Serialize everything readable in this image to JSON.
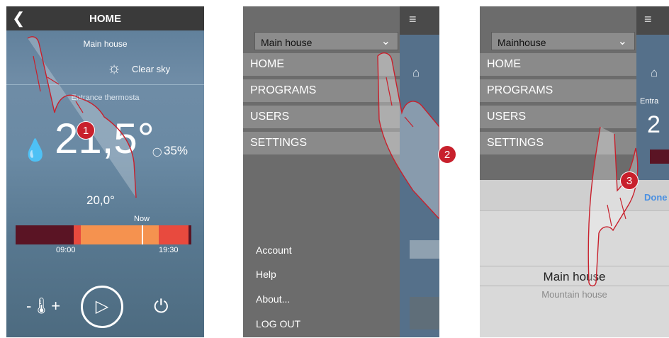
{
  "panel1": {
    "header_title": "HOME",
    "house_name": "Main house",
    "weather": "Clear sky",
    "thermostat_name": "Entrance thermosta",
    "temperature": "21,5°",
    "humidity": "35%",
    "setpoint": "20,0°",
    "timeline_now": "Now",
    "timeline_start": "09:00",
    "timeline_end": "19:30",
    "step_badge": "1",
    "colors": {
      "dark_red": "#5a1424",
      "orange": "#f5924f",
      "red": "#e84a3e"
    }
  },
  "panel2": {
    "selector_value": "Main house",
    "menu_items": [
      "HOME",
      "PROGRAMS",
      "USERS",
      "SETTINGS"
    ],
    "footer_items": [
      "Account",
      "Help",
      "About...",
      "LOG OUT"
    ],
    "step_badge": "2"
  },
  "panel3": {
    "selector_value": "Mainhouse",
    "menu_items": [
      "HOME",
      "PROGRAMS",
      "USERS",
      "SETTINGS"
    ],
    "side_label": "Entra",
    "side_temp": "2",
    "done_label": "Done",
    "picker_options": [
      "Main house",
      "Mountain house"
    ],
    "step_badge": "3"
  }
}
